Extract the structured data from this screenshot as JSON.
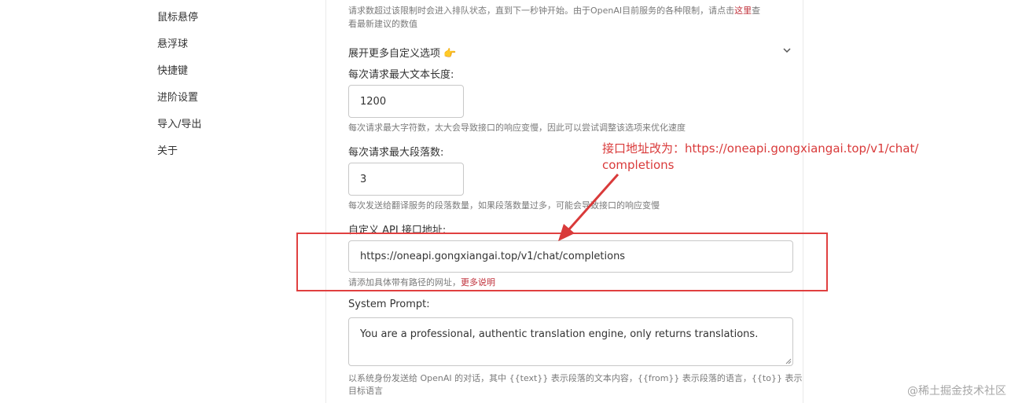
{
  "sidebar": {
    "items": [
      {
        "label": "鼠标悬停"
      },
      {
        "label": "悬浮球"
      },
      {
        "label": "快捷键"
      },
      {
        "label": "进阶设置"
      },
      {
        "label": "导入/导出"
      },
      {
        "label": "关于"
      }
    ]
  },
  "panel": {
    "top_help": {
      "line1_prefix": "请求数超过该限制时会进入排队状态，直到下一秒钟开始。由于OpenAI目前服务的各种限制，请点击",
      "link": "这里",
      "line1_suffix": "查",
      "line2": "看最新建议的数值"
    },
    "expand": {
      "label": "展开更多自定义选项",
      "emoji": "👉"
    },
    "max_text": {
      "label": "每次请求最大文本长度:",
      "value": "1200",
      "help": "每次请求最大字符数，太大会导致接口的响应变慢，因此可以尝试调整该选项来优化速度"
    },
    "max_paragraphs": {
      "label": "每次请求最大段落数:",
      "value": "3",
      "help": "每次发送给翻译服务的段落数量，如果段落数量过多，可能会导致接口的响应变慢"
    },
    "api_url": {
      "label": "自定义 API 接口地址:",
      "value": "https://oneapi.gongxiangai.top/v1/chat/completions",
      "help_prefix": "请添加具体带有路径的网址，",
      "help_link": "更多说明"
    },
    "system_prompt": {
      "label": "System Prompt:",
      "value": "You are a professional, authentic translation engine, only returns translations.",
      "help_line1": "以系统身份发送给 OpenAI 的对话，其中 {{text}} 表示段落的文本内容，{{from}} 表示段落的语言，{{to}} 表示",
      "help_line2": "目标语言"
    }
  },
  "annotation": {
    "line1": "接口地址改为：https://oneapi.gongxiangai.top/v1/chat/",
    "line2": "completions",
    "color": "#d93a3a"
  },
  "watermark": "@稀土掘金技术社区"
}
